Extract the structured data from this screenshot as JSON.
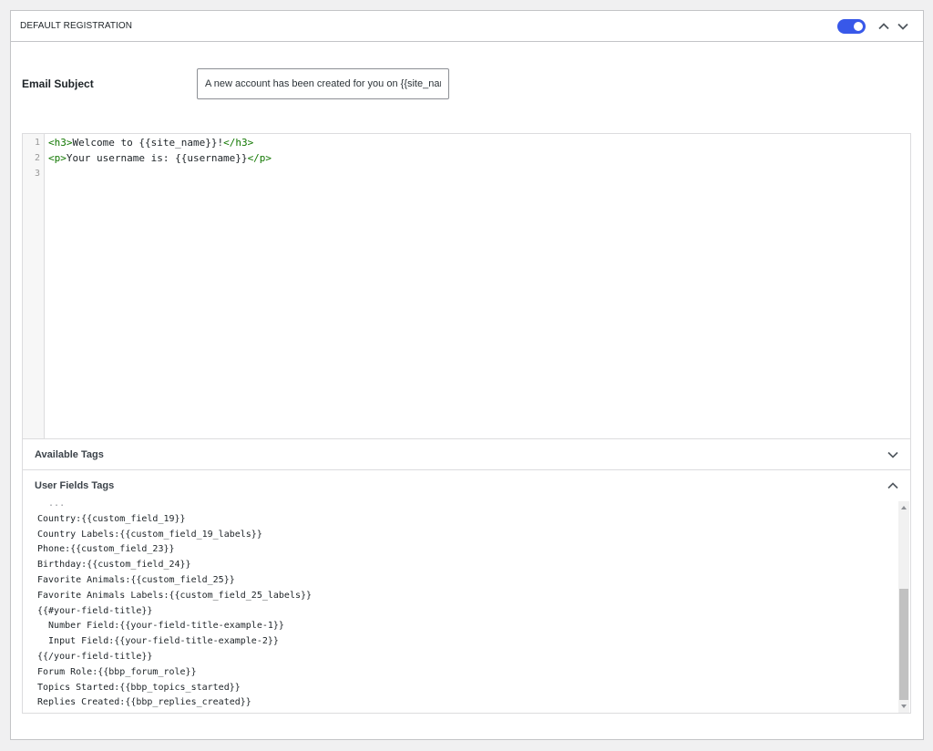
{
  "panel": {
    "title": "DEFAULT REGISTRATION",
    "enabled": true,
    "accent_color": "#3858e9",
    "icons": [
      "toggle",
      "chevron-up-icon",
      "chevron-down-icon"
    ]
  },
  "email_subject": {
    "label": "Email Subject",
    "value": "A new account has been created for you on {{site_name}}"
  },
  "editor": {
    "line_numbers": [
      "1",
      "2",
      "3"
    ],
    "lines": [
      {
        "open": "<h3>",
        "text": "Welcome to {{site_name}}!",
        "close": "</h3>"
      },
      {
        "open": "<p>",
        "text": "Your username is: {{username}}",
        "close": "</p>"
      },
      {
        "open": "",
        "text": "",
        "close": ""
      }
    ]
  },
  "available_tags": {
    "title": "Available Tags",
    "expanded": false
  },
  "user_fields_tags": {
    "title": "User Fields Tags",
    "expanded": true,
    "tags": [
      "Country:{{custom_field_19}}",
      "Country Labels:{{custom_field_19_labels}}",
      "Phone:{{custom_field_23}}",
      "Birthday:{{custom_field_24}}",
      "Favorite Animals:{{custom_field_25}}",
      "Favorite Animals Labels:{{custom_field_25_labels}}",
      "{{#your-field-title}}",
      "  Number Field:{{your-field-title-example-1}}",
      "  Input Field:{{your-field-title-example-2}}",
      "{{/your-field-title}}",
      "Forum Role:{{bbp_forum_role}}",
      "Topics Started:{{bbp_topics_started}}",
      "Replies Created:{{bbp_replies_created}}"
    ]
  }
}
